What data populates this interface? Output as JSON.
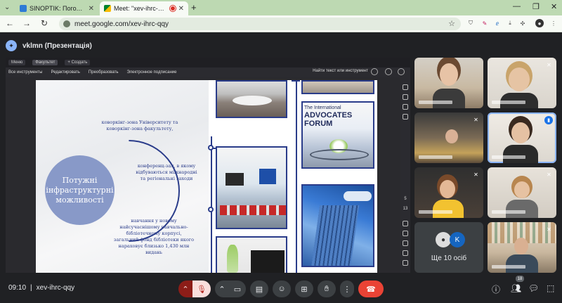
{
  "browser": {
    "tabs": [
      {
        "title": "SINOPTIK: Погода у Васильков",
        "active": false
      },
      {
        "title": "Meet: \"xev-ihrc-qqy\"",
        "active": true
      }
    ],
    "new_tab": "+",
    "url": "meet.google.com/xev-ihrc-qqy"
  },
  "presenter": {
    "avatar_letter": "✦",
    "title": "vklmn (Презентація)"
  },
  "shared_screen": {
    "window_tabs": [
      "Меню",
      "Факультет",
      "+ Создать"
    ],
    "toolbar": [
      "Все инструменты",
      "Редактировать",
      "Преобразовать",
      "Электронное подписание"
    ],
    "search_label": "Найти текст или инструмент",
    "side_numbers": [
      "5",
      "13"
    ],
    "slide": {
      "circle_title": "Потужні інфраструктурні можливості",
      "text_1": "коворкінг-зона Університету та коворкінг-зона факультету,",
      "text_2": "конференц-зал, в якому відбуваються міжнародні та регіональні заходи",
      "text_3": "навчання у новому найсучаснішому навчально-бібліотечному корпусі, загальний фонд бібліотеки якого нараховує близько 1,430 млн видань",
      "photo_caption_top": "The International",
      "photo_caption_main": "ADVOCATES FORUM"
    }
  },
  "participants": {
    "others_count_label": "Ще 10 осіб",
    "others_avatar_letter": "K"
  },
  "bottom_bar": {
    "time": "09:10",
    "meeting_code": "xev-ihrc-qqy",
    "people_badge": "18"
  }
}
